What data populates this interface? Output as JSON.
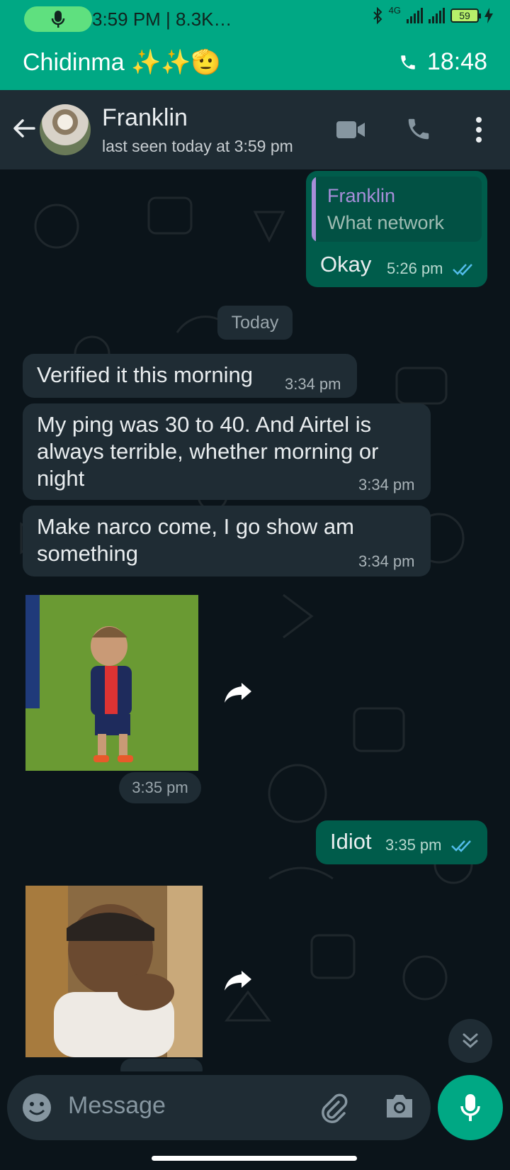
{
  "status_bar": {
    "text": "3:59 PM | 8.3K…",
    "network": "4G",
    "battery": "59"
  },
  "call_banner": {
    "name": "Chidinma ✨✨🫡",
    "timer": "18:48"
  },
  "header": {
    "contact_name": "Franklin",
    "last_seen": "last seen today at 3:59 pm"
  },
  "messages": {
    "m1": {
      "quote_name": "Franklin",
      "quote_text": "What network",
      "text": "Okay",
      "time": "5:26 pm"
    },
    "day_divider": "Today",
    "m2": {
      "text": "Verified it this morning",
      "time": "3:34 pm"
    },
    "m3": {
      "text": "My ping was 30 to 40. And Airtel is always terrible, whether morning or night",
      "time": "3:34 pm"
    },
    "m4": {
      "text": "Make narco come, I go show am something",
      "time": "3:34 pm"
    },
    "sticker1": {
      "time": "3:35 pm"
    },
    "m5": {
      "text": "Idiot",
      "time": "3:35 pm"
    }
  },
  "input": {
    "placeholder": "Message"
  },
  "colors": {
    "accent": "#00a884",
    "incoming": "#1f2c34",
    "outgoing": "#005c4b",
    "background": "#0b141a",
    "read_ticks": "#53bdeb"
  },
  "icons": [
    "mic-icon",
    "bluetooth-icon",
    "signal-icon",
    "battery-icon",
    "charging-icon",
    "phone-icon",
    "back-arrow-icon",
    "video-call-icon",
    "voice-call-icon",
    "more-options-icon",
    "forward-icon",
    "double-chevron-down-icon",
    "emoji-icon",
    "attach-icon",
    "camera-icon"
  ]
}
